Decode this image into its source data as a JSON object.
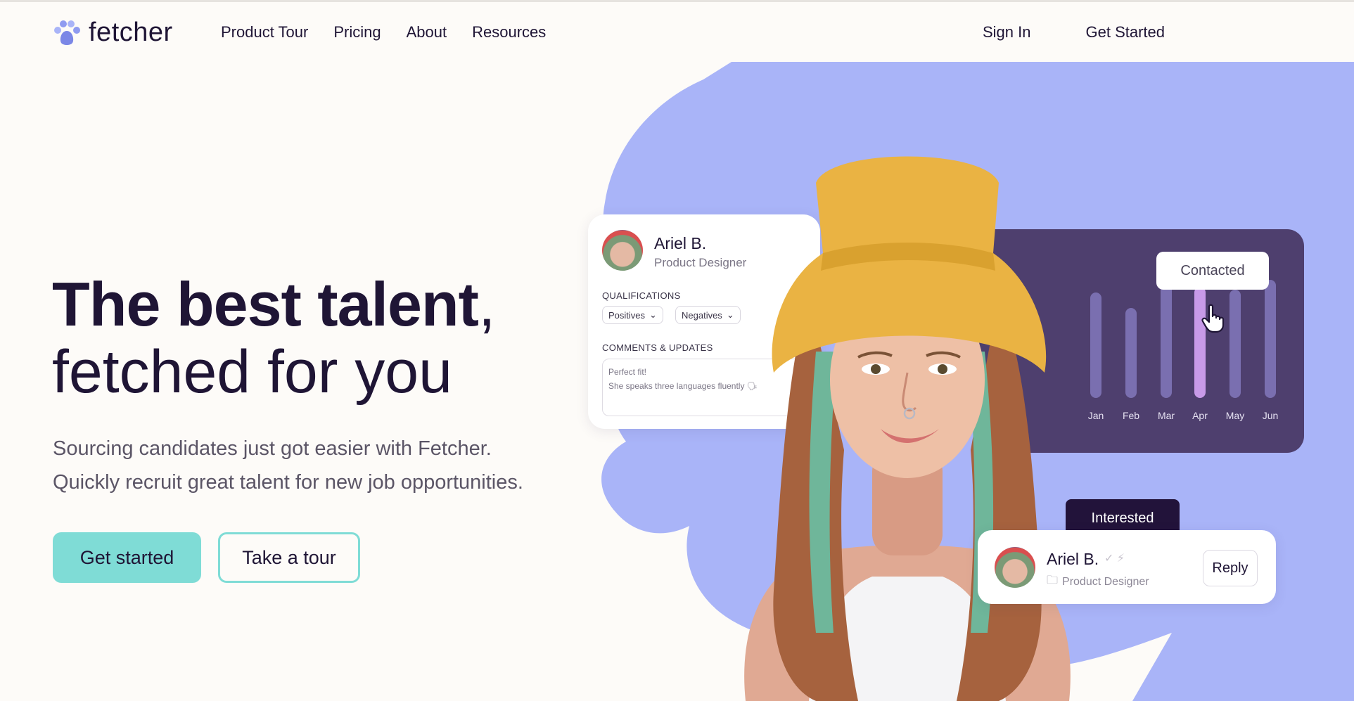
{
  "brand": {
    "name": "fetcher",
    "accent": "#7fdcd6",
    "blob": "#a9b4f8",
    "dark": "#1f1535"
  },
  "nav": {
    "links": [
      "Product Tour",
      "Pricing",
      "About",
      "Resources"
    ],
    "sign_in": "Sign In",
    "get_started": "Get Started"
  },
  "hero": {
    "title_bold": "The best talent",
    "title_comma": ",",
    "title_line2": "fetched for you",
    "subtitle_line1": "Sourcing candidates just got easier with Fetcher.",
    "subtitle_line2": "Quickly recruit great talent for new job opportunities.",
    "primary_cta": "Get started",
    "secondary_cta": "Take a tour"
  },
  "candidate_card": {
    "name": "Ariel B.",
    "role": "Product Designer",
    "qualifications_label": "QUALIFICATIONS",
    "chips": [
      "Positives",
      "Negatives"
    ],
    "comments_label": "COMMENTS & UPDATES",
    "comment_line1": "Perfect fit!",
    "comment_line2": "She speaks three languages fluently 🗣"
  },
  "chart_card": {
    "tooltip": "Contacted",
    "months": [
      "Jan",
      "Feb",
      "Mar",
      "Apr",
      "May",
      "Jun"
    ],
    "highlight_month": "Apr",
    "bar_color": "#7a6fb0",
    "highlight_color": "#c89ae8"
  },
  "reply_card": {
    "badge": "Interested",
    "name": "Ariel B.",
    "marks": "✓ ⚡",
    "role": "Product Designer",
    "reply": "Reply"
  }
}
